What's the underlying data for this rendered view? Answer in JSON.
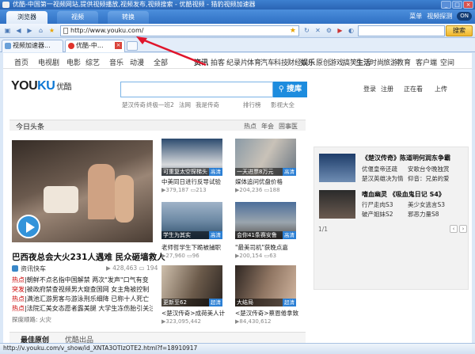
{
  "window": {
    "title": "优酷-中国第一视频网站,提供视频播放,视频发布,视频搜索 - 优酷视频 - 猎豹视频加速器"
  },
  "menubar": {
    "tabs": [
      "浏览器",
      "视频",
      "转换"
    ],
    "right_label": "菜单",
    "probe_label": "视频探测",
    "toggle": "ON"
  },
  "address": {
    "url": "http://www.youku.com/"
  },
  "toolbar": {
    "search_button": "搜索",
    "search_placeholder": ""
  },
  "browser_tabs": [
    {
      "label": "视频加速器..."
    },
    {
      "label": "优酷-中..."
    }
  ],
  "youku_nav": {
    "items": [
      "首页",
      "电视剧",
      "电影",
      "综艺",
      "音乐",
      "动漫",
      "全部"
    ],
    "funcs": [
      "资讯",
      "拍客",
      "纪录片",
      "体育",
      "汽车",
      "科技",
      "财经",
      "娱乐",
      "原创",
      "游戏",
      "搞笑",
      "生活",
      "时尚",
      "旅游",
      "教育",
      "客户端",
      "空间"
    ]
  },
  "logo": {
    "text_a": "YOU",
    "text_b": "KU",
    "text_cn": "优酷"
  },
  "search": {
    "button": "搜库",
    "hot_terms": [
      "楚汉传奇",
      "终极一班2",
      "法网",
      "我是传奇"
    ],
    "rank_label": "排行榜",
    "tv_label": "影视大全"
  },
  "user": {
    "login": "登录",
    "register": "注册",
    "watching": "正在看",
    "upload": "上传"
  },
  "feed": {
    "title": "今日头条",
    "tabs": [
      "热点",
      "年会",
      "固事医"
    ]
  },
  "headline": {
    "title": "巴西夜总会大火231人遇难 民众砸墙救人",
    "source": "资讯快车",
    "views": "428,463",
    "likes": "194",
    "hot_items": [
      {
        "tag": "热点",
        "text": "|朝鲜不点名指中国解禁 两次\"发声\"口气有变"
      },
      {
        "tag": "突发",
        "text": "|被政府禁查视频男大窥查国网 女主角被控制"
      },
      {
        "tag": "热点",
        "text": "|满池汇游男客与游泳刑乐细降 已称十人死亡"
      },
      {
        "tag": "热点",
        "text": "|法院汇美女态愿者露美腿 大学生冻伤胎引关注"
      }
    ],
    "recommend": "探度顺路: 火灾"
  },
  "videos": [
    {
      "caption": "可重复太空探梯头",
      "badge": "高清",
      "title": "中美同日进行反导试验",
      "views": "379,187",
      "comments": "213"
    },
    {
      "caption": "一天进票8万元",
      "badge": "高清",
      "title": "媒体追问优盘价格",
      "views": "204,236",
      "comments": "188"
    },
    {
      "caption": "学生为其实",
      "badge": "高清",
      "title": "老师哲学生下跪被捕职",
      "views": "27,960",
      "comments": "96"
    },
    {
      "caption": "会你41条赛安鲁",
      "badge": "高清",
      "title": "\"最美司机\"获晚点嘉",
      "views": "200,154",
      "comments": "63"
    },
    {
      "caption": "更新至62",
      "badge": "超清",
      "title": "<楚汉传奇>成荷美人计",
      "views": "323,095,442",
      "comments": ""
    },
    {
      "caption": "大结局",
      "badge": "超清",
      "title": "<楚汉传奇>蔡恩倦拿致命",
      "views": "84,430,612",
      "comments": ""
    }
  ],
  "bottom_tabs": [
    "最佳原创",
    "优酷出品"
  ],
  "ad": {
    "show1": "《楚汉传奇》陈道明何润东争霸",
    "show1_items": [
      "优偃皇帝还疏",
      "楚汉英雄决为情",
      "安歌台令晚独赏",
      "仰音：兄弟的爱"
    ],
    "show2": "嗜血幽灵 《吸血鬼日记 S4》",
    "show2_items": [
      "行尸走肉S3",
      "破产姐妹S2",
      "美少女逃言S3",
      "邪恶力量S8"
    ],
    "page": "1/1"
  },
  "status": {
    "text": "http://v.youku.com/v_show/id_XNTA3OTIzOTE2.html?f=18910917"
  },
  "colors": {
    "accent": "#1d8cde",
    "title_bar": "#3d80d0",
    "hot_tag": "#c00"
  }
}
